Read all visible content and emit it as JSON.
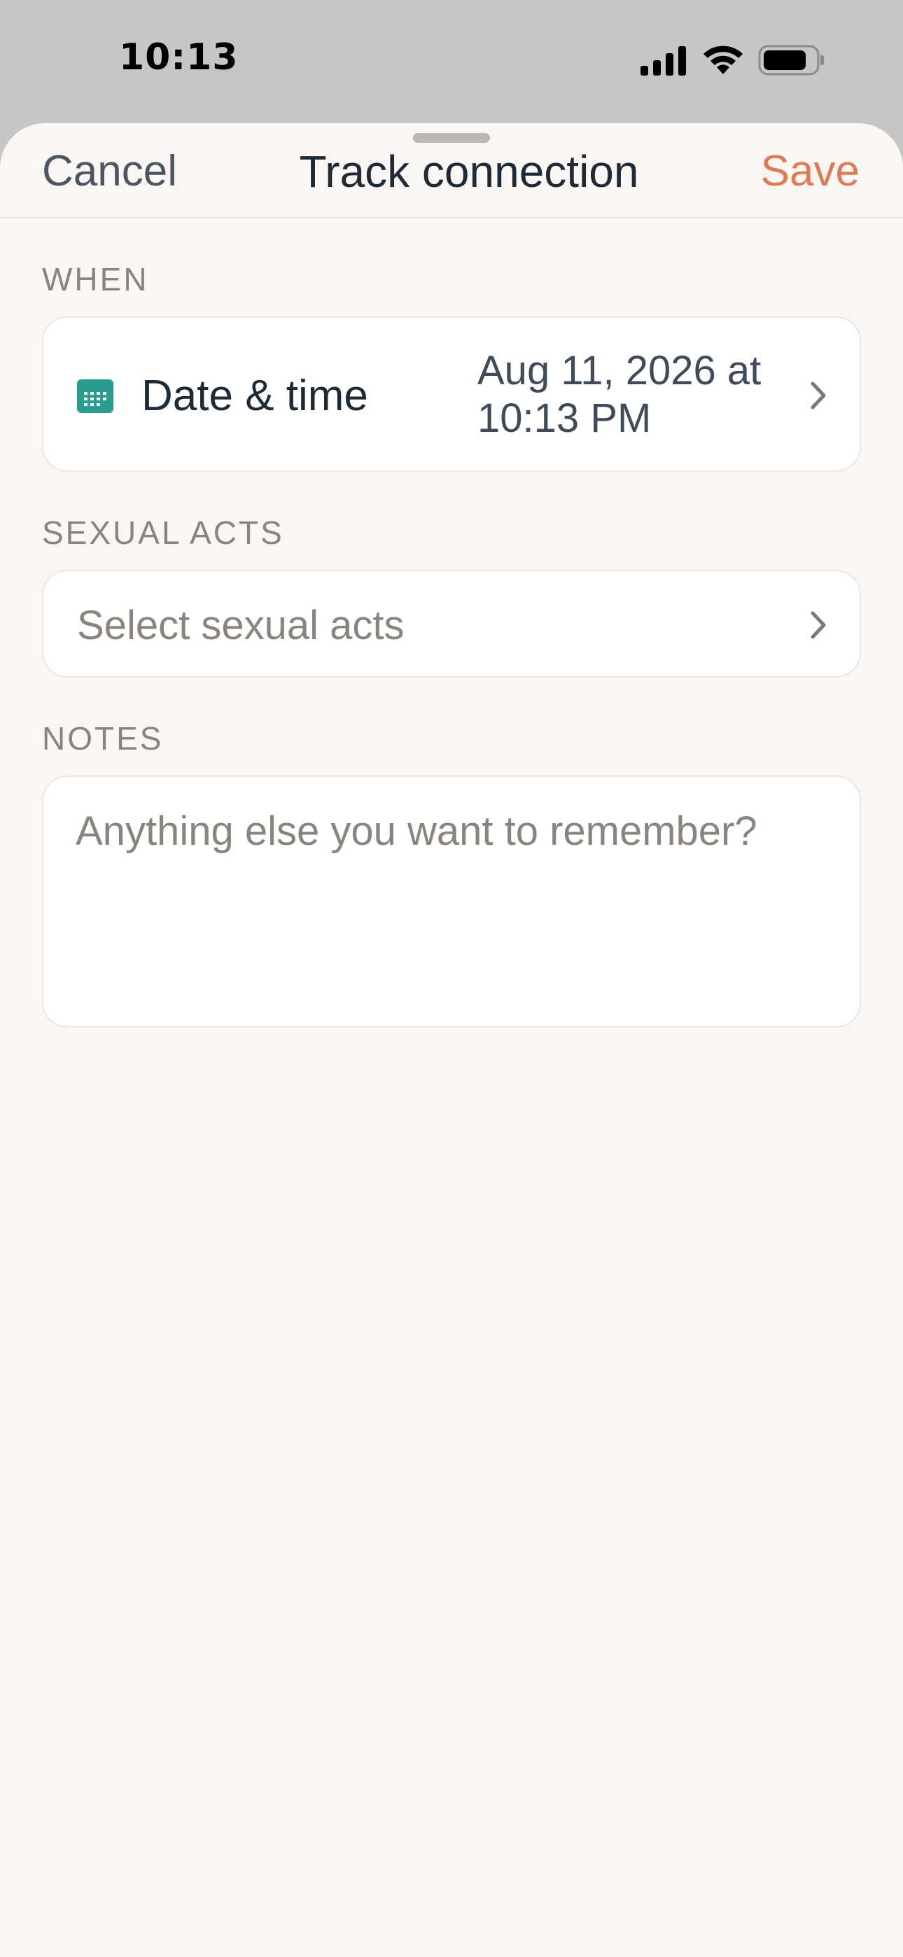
{
  "status_bar": {
    "time": "10:13",
    "icons": [
      "signal-icon",
      "wifi-icon",
      "battery-icon"
    ]
  },
  "nav": {
    "cancel_label": "Cancel",
    "title": "Track connection",
    "save_label": "Save"
  },
  "sections": {
    "when": {
      "label": "WHEN",
      "row_label": "Date & time",
      "row_value": "Aug 11, 2026 at 10:13 PM",
      "icon": "calendar-icon"
    },
    "sexual_acts": {
      "label": "SEXUAL ACTS",
      "placeholder": "Select sexual acts"
    },
    "notes": {
      "label": "NOTES",
      "placeholder": "Anything else you want to remember?",
      "value": ""
    }
  },
  "colors": {
    "accent": "#e07a52",
    "calendar_icon": "#2a9d8f",
    "sheet_background": "#faf6f3",
    "backdrop": "#c6c6c5"
  }
}
